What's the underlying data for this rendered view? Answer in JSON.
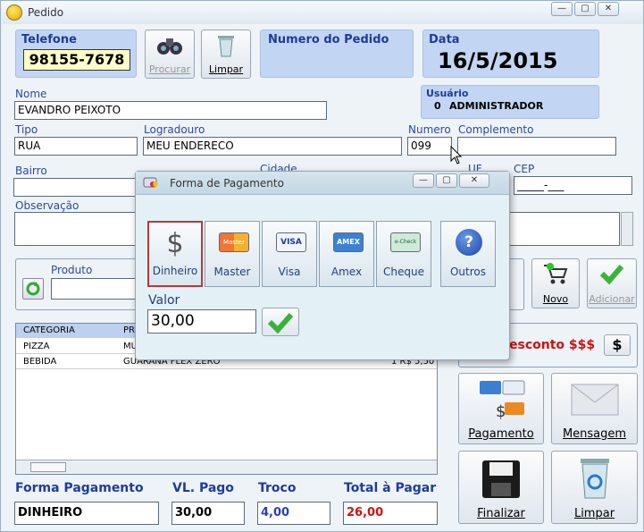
{
  "window": {
    "title": "Pedido",
    "min": "—",
    "max": "▢",
    "close": "✕"
  },
  "telefone": {
    "label": "Telefone",
    "value": "98155-7678"
  },
  "buttons": {
    "procurar": "Procurar",
    "limpar": "Limpar",
    "novo": "Novo",
    "adicionar": "Adicionar",
    "pagamento": "Pagamento",
    "mensagem": "Mensagem",
    "finalizar": "Finalizar",
    "limpar2": "Limpar",
    "desconto_btn": "$"
  },
  "pedido": {
    "label": "Numero do Pedido"
  },
  "data": {
    "label": "Data",
    "value": "16/5/2015"
  },
  "usuario": {
    "label": "Usuário",
    "id": "0",
    "name": "ADMINISTRADOR"
  },
  "form": {
    "nome_label": "Nome",
    "nome": "EVANDRO PEIXOTO",
    "tipo_label": "Tipo",
    "tipo": "RUA",
    "logradouro_label": "Logradouro",
    "logradouro": "MEU ENDERECO",
    "numero_label": "Numero",
    "numero": "099",
    "complemento_label": "Complemento",
    "complemento": "",
    "bairro_label": "Bairro",
    "cidade_label": "Cidade",
    "uf_label": "UF",
    "cep_label": "CEP",
    "cep": "_____-___",
    "obs_label": "Observação",
    "produto_label": "Produto"
  },
  "grid": {
    "headers": [
      "CATEGORIA",
      "PR"
    ],
    "rows": [
      {
        "cat": "PIZZA",
        "prod": "MU"
      },
      {
        "cat": "BEBIDA",
        "prod": "GUARANA FLEX ZERO",
        "val": "1  R$ 5,50"
      }
    ]
  },
  "desconto": {
    "label": "esconto $$$"
  },
  "totals": {
    "forma_label": "Forma Pagamento",
    "forma": "DINHEIRO",
    "pago_label": "VL. Pago",
    "pago": "30,00",
    "troco_label": "Troco",
    "troco": "4,00",
    "total_label": "Total à Pagar",
    "total": "26,00"
  },
  "dialog": {
    "title": "Forma de Pagamento",
    "methods": [
      "Dinheiro",
      "Master",
      "Visa",
      "Amex",
      "Cheque",
      "Outros"
    ],
    "card_master": "Master",
    "card_visa": "VISA",
    "card_amex": "AMEX",
    "card_check": "e-Check",
    "dollar": "$",
    "outros_glyph": "?",
    "valor_label": "Valor",
    "valor": "30,00"
  },
  "colors": {
    "accent": "#1e3c9a",
    "red": "#d01010",
    "troco": "#2a3fc0"
  }
}
